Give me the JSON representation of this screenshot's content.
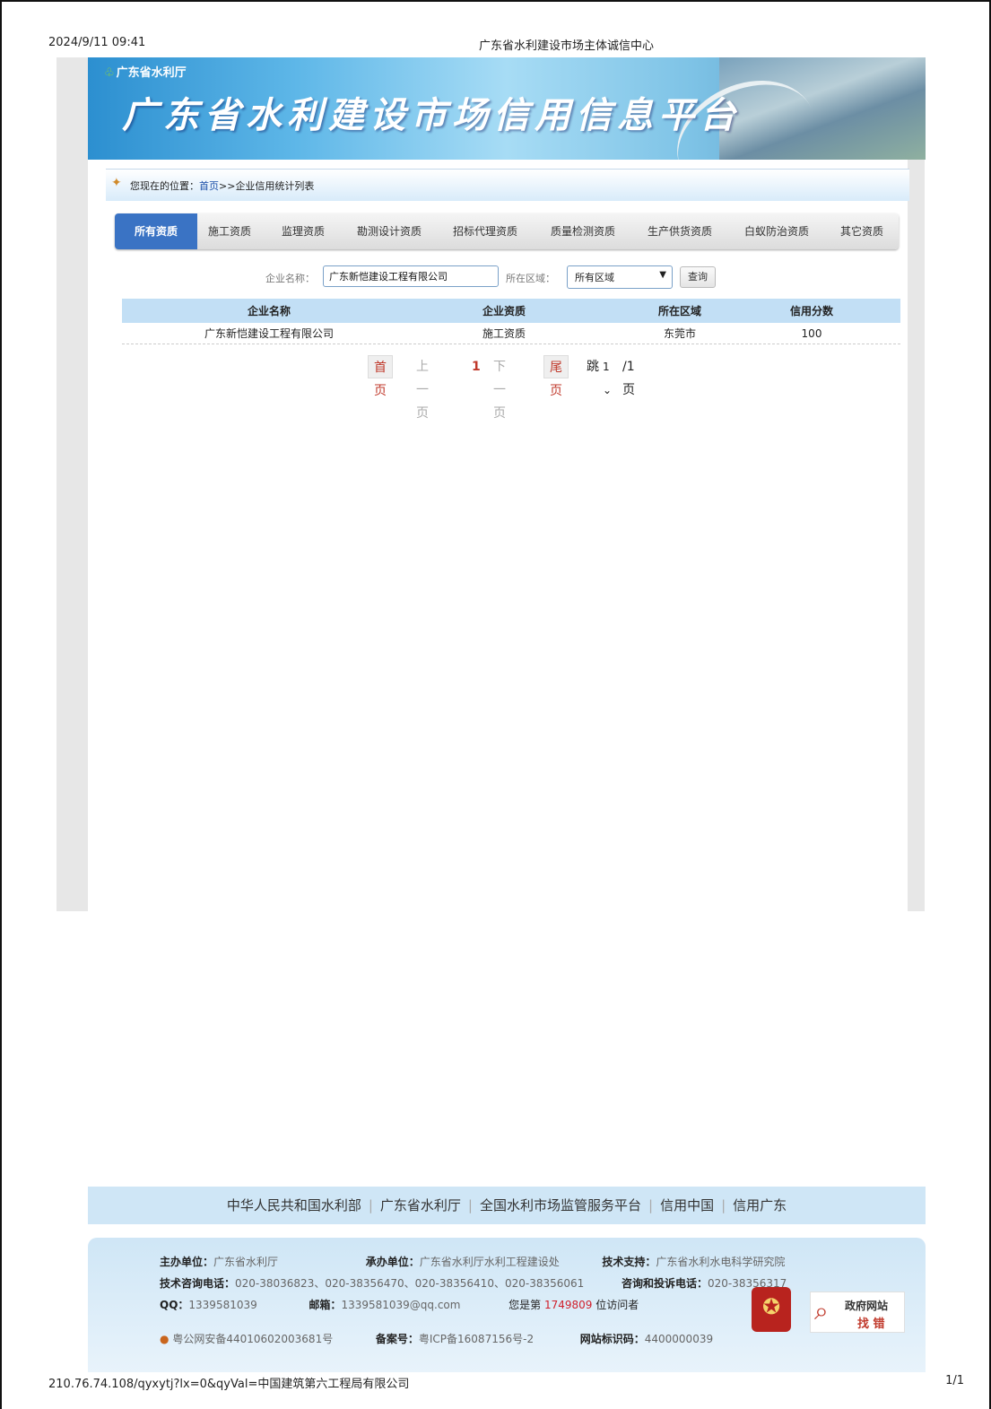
{
  "print_header": {
    "timestamp": "2024/9/11 09:41",
    "title": "广东省水利建设市场主体诚信中心"
  },
  "print_footer": {
    "url": "210.76.74.108/qyxytj?lx=0&qyVal=中国建筑第六工程局有限公司",
    "page": "1/1"
  },
  "banner": {
    "dept": "广东省水利厅",
    "title": "广东省水利建设市场信用信息平台"
  },
  "breadcrumb": {
    "prefix": "您现在的位置：",
    "home": "首页",
    "sep": ">>",
    "current": "企业信用统计列表"
  },
  "tabs": [
    "所有资质",
    "施工资质",
    "监理资质",
    "勘测设计资质",
    "招标代理资质",
    "质量检测资质",
    "生产供货资质",
    "白蚁防治资质",
    "其它资质"
  ],
  "search": {
    "company_label": "企业名称：",
    "company_value": "广东新恺建设工程有限公司",
    "region_label": "所在区域：",
    "region_value": "所有区域",
    "button": "查询"
  },
  "table": {
    "headers": [
      "企业名称",
      "企业资质",
      "所在区域",
      "信用分数"
    ],
    "rows": [
      [
        "广东新恺建设工程有限公司",
        "施工资质",
        "东莞市",
        "100"
      ]
    ]
  },
  "pager": {
    "first": "首页",
    "prev": "上一页",
    "current": "1",
    "next": "下一页",
    "last": "尾页",
    "jump": "跳",
    "jump_value": "1",
    "total": "/1页"
  },
  "links": [
    "中华人民共和国水利部",
    "广东省水利厅",
    "全国水利市场监管服务平台",
    "信用中国",
    "信用广东"
  ],
  "footer": {
    "host_label": "主办单位：",
    "host": "广东省水利厅",
    "undertake_label": "承办单位：",
    "undertake": "广东省水利厅水利工程建设处",
    "support_label": "技术支持：",
    "support": "广东省水利水电科学研究院",
    "tech_phone_label": "技术咨询电话：",
    "tech_phone": "020-38036823、020-38356470、020-38356410、020-38356061",
    "complaint_label": "咨询和投诉电话：",
    "complaint": "020-38356317",
    "qq_label": "QQ：",
    "qq": "1339581039",
    "mail_label": "邮箱：",
    "mail": "1339581039@qq.com",
    "visitor_prefix": "您是第 ",
    "visitor_count": "1749809",
    "visitor_suffix": " 位访问者",
    "police": "粤公网安备44010602003681号",
    "icp_label": "备案号：",
    "icp": "粤ICP备16087156号-2",
    "site_id_label": "网站标识码：",
    "site_id": "4400000039",
    "find_title": "政府网站",
    "find_sub": "找 错"
  }
}
